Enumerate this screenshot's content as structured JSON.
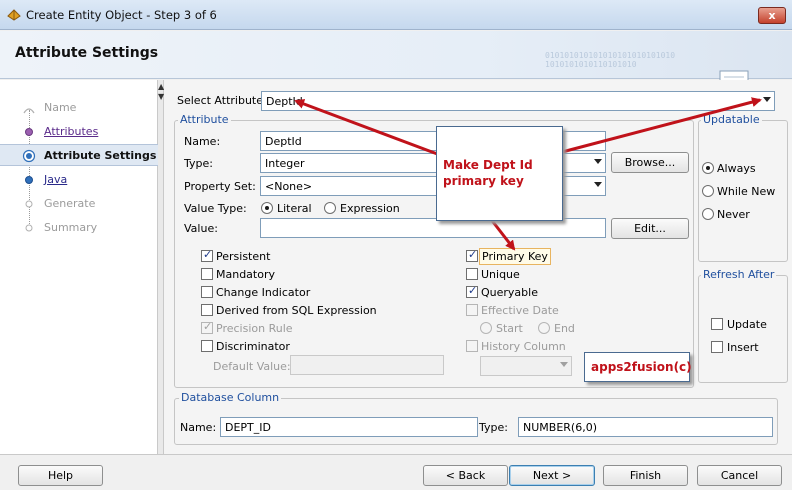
{
  "window": {
    "title": "Create Entity Object - Step 3 of 6",
    "close_label": "x"
  },
  "header": {
    "title": "Attribute Settings",
    "binary_text": "010101010101010101010101010 1010101010110101010"
  },
  "steps": [
    {
      "label": "Name",
      "state": "disabled"
    },
    {
      "label": "Attributes",
      "state": "link"
    },
    {
      "label": "Attribute Settings",
      "state": "active"
    },
    {
      "label": "Java",
      "state": "link"
    },
    {
      "label": "Generate",
      "state": "disabled"
    },
    {
      "label": "Summary",
      "state": "disabled"
    }
  ],
  "select_attribute": {
    "label": "Select Attribute",
    "value": "DeptId"
  },
  "attribute": {
    "group_label": "Attribute",
    "name_label": "Name:",
    "name_value": "DeptId",
    "type_label": "Type:",
    "type_value": "Integer",
    "browse_label": "Browse...",
    "property_set_label": "Property Set:",
    "property_set_value": "<None>",
    "value_type_label": "Value Type:",
    "literal_label": "Literal",
    "expression_label": "Expression",
    "value_label": "Value:",
    "value_value": "",
    "edit_label": "Edit..."
  },
  "checkboxes_left": [
    {
      "label": "Persistent",
      "checked": true,
      "enabled": true
    },
    {
      "label": "Mandatory",
      "checked": false,
      "enabled": true
    },
    {
      "label": "Change Indicator",
      "checked": false,
      "enabled": true
    },
    {
      "label": "Derived from SQL Expression",
      "checked": false,
      "enabled": true
    },
    {
      "label": "Precision Rule",
      "checked": true,
      "enabled": false
    },
    {
      "label": "Discriminator",
      "checked": false,
      "enabled": true
    }
  ],
  "default_value_label": "Default Value:",
  "checkboxes_right": [
    {
      "label": "Primary Key",
      "checked": true,
      "enabled": true
    },
    {
      "label": "Unique",
      "checked": false,
      "enabled": true
    },
    {
      "label": "Queryable",
      "checked": true,
      "enabled": true
    },
    {
      "label": "Effective Date",
      "checked": false,
      "enabled": false
    }
  ],
  "effective_date": {
    "start_label": "Start",
    "end_label": "End"
  },
  "history_column": {
    "label": "History Column",
    "value": ""
  },
  "updatable": {
    "group_label": "Updatable",
    "options": [
      "Always",
      "While New",
      "Never"
    ],
    "selected": "Always"
  },
  "refresh_after": {
    "group_label": "Refresh After",
    "update_label": "Update",
    "insert_label": "Insert"
  },
  "database_column": {
    "group_label": "Database Column",
    "name_label": "Name:",
    "name_value": "DEPT_ID",
    "type_label": "Type:",
    "type_value": "NUMBER(6,0)"
  },
  "callout": {
    "text": "Make Dept Id primary key"
  },
  "watermark": {
    "text": "apps2fusion(c)"
  },
  "footer": {
    "help": "Help",
    "back": "< Back",
    "next": "Next >",
    "finish": "Finish",
    "cancel": "Cancel"
  },
  "colors": {
    "annotation_red": "#c0121a",
    "group_label_blue": "#1f4f9e"
  }
}
